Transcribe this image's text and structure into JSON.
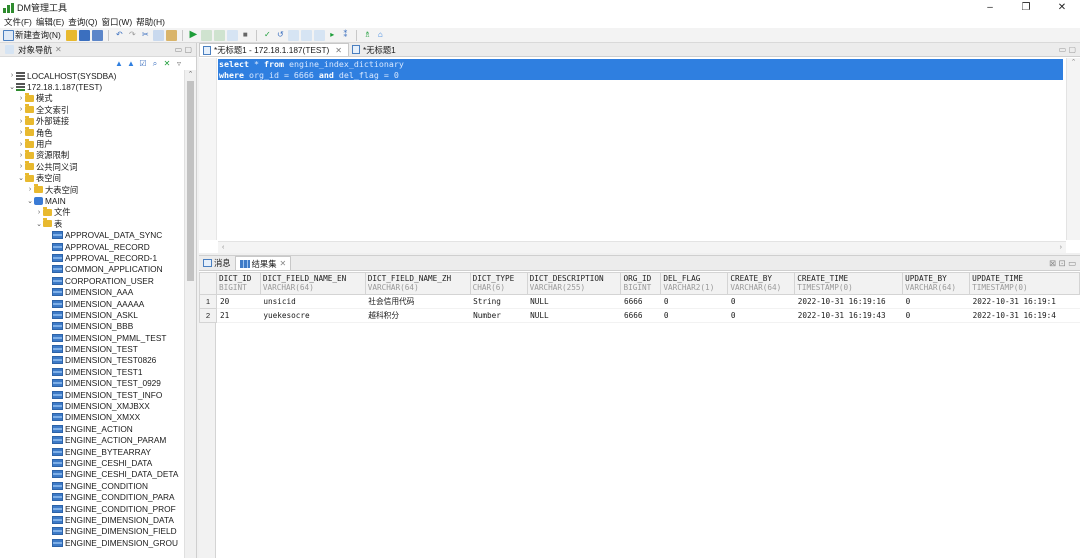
{
  "window": {
    "title": "DM管理工具",
    "controls": [
      "–",
      "❐",
      "✕"
    ]
  },
  "menu": [
    "文件(F)",
    "编辑(E)",
    "查询(Q)",
    "窗口(W)",
    "帮助(H)"
  ],
  "toolbar": {
    "new_query": "新建查询(N)"
  },
  "navigator": {
    "title": "对象导航",
    "tree": [
      {
        "level": 0,
        "chev": ">",
        "icon": "db",
        "label": "LOCALHOST(SYSDBA)"
      },
      {
        "level": 0,
        "chev": "v",
        "icon": "dbg",
        "label": "172.18.1.187(TEST)"
      },
      {
        "level": 1,
        "chev": ">",
        "icon": "folder",
        "label": "模式"
      },
      {
        "level": 1,
        "chev": ">",
        "icon": "folder",
        "label": "全文索引"
      },
      {
        "level": 1,
        "chev": ">",
        "icon": "folder",
        "label": "外部链接"
      },
      {
        "level": 1,
        "chev": ">",
        "icon": "folder",
        "label": "角色"
      },
      {
        "level": 1,
        "chev": ">",
        "icon": "folder",
        "label": "用户"
      },
      {
        "level": 1,
        "chev": ">",
        "icon": "folder",
        "label": "资源限制"
      },
      {
        "level": 1,
        "chev": ">",
        "icon": "folder",
        "label": "公共同义词"
      },
      {
        "level": 1,
        "chev": "v",
        "icon": "folder",
        "label": "表空间"
      },
      {
        "level": 2,
        "chev": ">",
        "icon": "folder",
        "label": "大表空间"
      },
      {
        "level": 2,
        "chev": "v",
        "icon": "schema",
        "label": "MAIN"
      },
      {
        "level": 3,
        "chev": ">",
        "icon": "folder",
        "label": "文件"
      },
      {
        "level": 3,
        "chev": "v",
        "icon": "folder",
        "label": "表"
      },
      {
        "level": 4,
        "chev": "",
        "icon": "table",
        "label": "APPROVAL_DATA_SYNC"
      },
      {
        "level": 4,
        "chev": "",
        "icon": "table",
        "label": "APPROVAL_RECORD"
      },
      {
        "level": 4,
        "chev": "",
        "icon": "table",
        "label": "APPROVAL_RECORD-1"
      },
      {
        "level": 4,
        "chev": "",
        "icon": "table",
        "label": "COMMON_APPLICATION"
      },
      {
        "level": 4,
        "chev": "",
        "icon": "table",
        "label": "CORPORATION_USER"
      },
      {
        "level": 4,
        "chev": "",
        "icon": "table",
        "label": "DIMENSION_AAA"
      },
      {
        "level": 4,
        "chev": "",
        "icon": "table",
        "label": "DIMENSION_AAAAA"
      },
      {
        "level": 4,
        "chev": "",
        "icon": "table",
        "label": "DIMENSION_ASKL"
      },
      {
        "level": 4,
        "chev": "",
        "icon": "table",
        "label": "DIMENSION_BBB"
      },
      {
        "level": 4,
        "chev": "",
        "icon": "table",
        "label": "DIMENSION_PMML_TEST"
      },
      {
        "level": 4,
        "chev": "",
        "icon": "table",
        "label": "DIMENSION_TEST"
      },
      {
        "level": 4,
        "chev": "",
        "icon": "table",
        "label": "DIMENSION_TEST0826"
      },
      {
        "level": 4,
        "chev": "",
        "icon": "table",
        "label": "DIMENSION_TEST1"
      },
      {
        "level": 4,
        "chev": "",
        "icon": "table",
        "label": "DIMENSION_TEST_0929"
      },
      {
        "level": 4,
        "chev": "",
        "icon": "table",
        "label": "DIMENSION_TEST_INFO"
      },
      {
        "level": 4,
        "chev": "",
        "icon": "table",
        "label": "DIMENSION_XMJBXX"
      },
      {
        "level": 4,
        "chev": "",
        "icon": "table",
        "label": "DIMENSION_XMXX"
      },
      {
        "level": 4,
        "chev": "",
        "icon": "table",
        "label": "ENGINE_ACTION"
      },
      {
        "level": 4,
        "chev": "",
        "icon": "table",
        "label": "ENGINE_ACTION_PARAM"
      },
      {
        "level": 4,
        "chev": "",
        "icon": "table",
        "label": "ENGINE_BYTEARRAY"
      },
      {
        "level": 4,
        "chev": "",
        "icon": "table",
        "label": "ENGINE_CESHI_DATA"
      },
      {
        "level": 4,
        "chev": "",
        "icon": "table",
        "label": "ENGINE_CESHI_DATA_DETA"
      },
      {
        "level": 4,
        "chev": "",
        "icon": "table",
        "label": "ENGINE_CONDITION"
      },
      {
        "level": 4,
        "chev": "",
        "icon": "table",
        "label": "ENGINE_CONDITION_PARA"
      },
      {
        "level": 4,
        "chev": "",
        "icon": "table",
        "label": "ENGINE_CONDITION_PROF"
      },
      {
        "level": 4,
        "chev": "",
        "icon": "table",
        "label": "ENGINE_DIMENSION_DATA"
      },
      {
        "level": 4,
        "chev": "",
        "icon": "table",
        "label": "ENGINE_DIMENSION_FIELD"
      },
      {
        "level": 4,
        "chev": "",
        "icon": "table",
        "label": "ENGINE_DIMENSION_GROU"
      }
    ]
  },
  "editor": {
    "tabs": [
      {
        "label": "*无标题1 - 172.18.1.187(TEST)",
        "active": true,
        "close": "✕"
      },
      {
        "label": "*无标题1",
        "active": false,
        "close": ""
      }
    ],
    "sql_lines": [
      [
        {
          "t": "kw",
          "v": "select"
        },
        {
          "t": "id",
          "v": " * "
        },
        {
          "t": "kw",
          "v": "from"
        },
        {
          "t": "id",
          "v": " engine_index_dictionary"
        }
      ],
      [
        {
          "t": "kw",
          "v": "where"
        },
        {
          "t": "id",
          "v": " org_id = 6666 "
        },
        {
          "t": "kw",
          "v": "and"
        },
        {
          "t": "id",
          "v": " del_flag = 0"
        }
      ]
    ]
  },
  "results": {
    "tabs": [
      {
        "label": "消息",
        "active": false,
        "icon": "msg"
      },
      {
        "label": "结果集",
        "active": true,
        "icon": "grid"
      }
    ],
    "columns": [
      {
        "name": "DICT_ID",
        "type": "BIGINT",
        "w": 44
      },
      {
        "name": "DICT_FIELD_NAME_EN",
        "type": "VARCHAR(64)",
        "w": 105
      },
      {
        "name": "DICT_FIELD_NAME_ZH",
        "type": "VARCHAR(64)",
        "w": 105
      },
      {
        "name": "DICT_TYPE",
        "type": "CHAR(6)",
        "w": 57
      },
      {
        "name": "DICT_DESCRIPTION",
        "type": "VARCHAR(255)",
        "w": 94
      },
      {
        "name": "ORG_ID",
        "type": "BIGINT",
        "w": 40
      },
      {
        "name": "DEL_FLAG",
        "type": "VARCHAR2(1)",
        "w": 67
      },
      {
        "name": "CREATE_BY",
        "type": "VARCHAR(64)",
        "w": 67
      },
      {
        "name": "CREATE_TIME",
        "type": "TIMESTAMP(0)",
        "w": 108
      },
      {
        "name": "UPDATE_BY",
        "type": "VARCHAR(64)",
        "w": 67
      },
      {
        "name": "UPDATE_TIME",
        "type": "TIMESTAMP(0)",
        "w": 110
      }
    ],
    "rows": [
      {
        "n": "1",
        "cells": [
          "20",
          "unsicid",
          "社会信用代码",
          "String",
          "NULL",
          "6666",
          "0",
          "0",
          "2022-10-31 16:19:16",
          "0",
          "2022-10-31 16:19:1"
        ]
      },
      {
        "n": "2",
        "cells": [
          "21",
          "yuekesocre",
          "越科积分",
          "Number",
          "NULL",
          "6666",
          "0",
          "0",
          "2022-10-31 16:19:43",
          "0",
          "2022-10-31 16:19:4"
        ]
      }
    ]
  },
  "colors": {
    "selection": "#2f7fe0",
    "folder": "#e8b92f",
    "table_icon": "#3d7ac7"
  }
}
